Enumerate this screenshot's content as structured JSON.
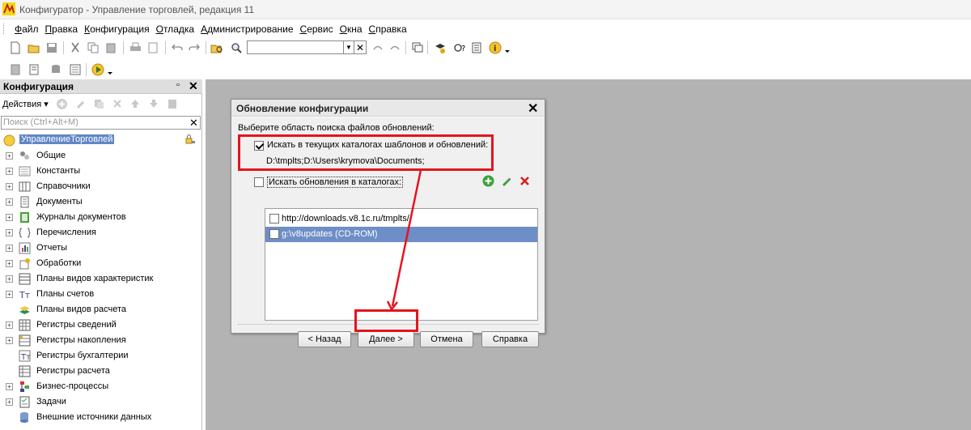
{
  "window": {
    "title": "Конфигуратор - Управление торговлей, редакция 11"
  },
  "menu": {
    "items": [
      {
        "u": "Ф",
        "rest": "айл"
      },
      {
        "u": "П",
        "rest": "равка"
      },
      {
        "u": "К",
        "rest": "онфигурация"
      },
      {
        "u": "О",
        "rest": "тладка"
      },
      {
        "u": "А",
        "rest": "дминистрирование"
      },
      {
        "u": "С",
        "rest": "ервис"
      },
      {
        "u": "О",
        "rest": "кна"
      },
      {
        "u": "С",
        "rest": "правка"
      }
    ]
  },
  "config_panel": {
    "title": "Конфигурация",
    "actions_label": "Действия",
    "search_placeholder": "Поиск (Ctrl+Alt+M)",
    "root": "УправлениеТорговлей",
    "items": [
      {
        "label": "Общие",
        "icon": "common-icon"
      },
      {
        "label": "Константы",
        "icon": "constants-icon"
      },
      {
        "label": "Справочники",
        "icon": "catalogs-icon"
      },
      {
        "label": "Документы",
        "icon": "documents-icon"
      },
      {
        "label": "Журналы документов",
        "icon": "journals-icon"
      },
      {
        "label": "Перечисления",
        "icon": "enums-icon"
      },
      {
        "label": "Отчеты",
        "icon": "reports-icon"
      },
      {
        "label": "Обработки",
        "icon": "processing-icon"
      },
      {
        "label": "Планы видов характеристик",
        "icon": "char-plans-icon"
      },
      {
        "label": "Планы счетов",
        "icon": "accounts-plans-icon"
      },
      {
        "label": "Планы видов расчета",
        "icon": "calc-plans-icon"
      },
      {
        "label": "Регистры сведений",
        "icon": "info-registers-icon"
      },
      {
        "label": "Регистры накопления",
        "icon": "accum-registers-icon"
      },
      {
        "label": "Регистры бухгалтерии",
        "icon": "account-registers-icon"
      },
      {
        "label": "Регистры расчета",
        "icon": "calc-registers-icon"
      },
      {
        "label": "Бизнес-процессы",
        "icon": "business-processes-icon"
      },
      {
        "label": "Задачи",
        "icon": "tasks-icon"
      },
      {
        "label": "Внешние источники данных",
        "icon": "external-sources-icon"
      }
    ]
  },
  "dialog": {
    "title": "Обновление конфигурации",
    "prompt": "Выберите область поиска файлов обновлений:",
    "option1_label": "Искать в текущих каталогах шаблонов и обновлений:",
    "option1_checked": true,
    "option1_path": "D:\\tmplts;D:\\Users\\krymova\\Documents;",
    "option2_label": "Искать обновления в каталогах:",
    "option2_checked": false,
    "list": [
      {
        "text": "http://downloads.v8.1c.ru/tmplts/",
        "checked": false,
        "selected": false
      },
      {
        "text": "g:\\v8updates (CD-ROM)",
        "checked": false,
        "selected": true
      }
    ],
    "buttons": {
      "back": "< Назад",
      "next": "Далее >",
      "cancel": "Отмена",
      "help": "Справка"
    }
  },
  "colors": {
    "highlight_red": "#e4141e",
    "selection_blue": "#6d8ec6",
    "workspace_gray": "#b3b3b3"
  }
}
